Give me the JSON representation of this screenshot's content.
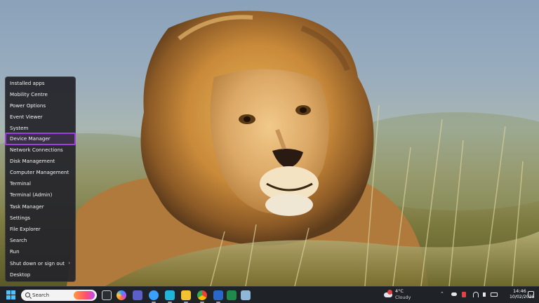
{
  "win_x_menu": {
    "items": [
      {
        "label": "Installed apps"
      },
      {
        "label": "Mobility Centre"
      },
      {
        "label": "Power Options"
      },
      {
        "label": "Event Viewer"
      },
      {
        "label": "System"
      },
      {
        "label": "Device Manager",
        "highlighted": true
      },
      {
        "label": "Network Connections"
      },
      {
        "label": "Disk Management"
      },
      {
        "label": "Computer Management"
      },
      {
        "label": "Terminal"
      },
      {
        "label": "Terminal (Admin)"
      },
      {
        "label": "Task Manager"
      },
      {
        "label": "Settings"
      },
      {
        "label": "File Explorer"
      },
      {
        "label": "Search"
      },
      {
        "label": "Run"
      },
      {
        "label": "Shut down or sign out",
        "submenu_indicator": "›"
      },
      {
        "label": "Desktop"
      }
    ],
    "highlight_color": "#9b3fe0"
  },
  "taskbar": {
    "search": {
      "placeholder": "Search"
    },
    "pinned_icons": [
      "task-view-icon",
      "copilot-icon",
      "teams-icon",
      "widgets-icon",
      "edge-icon",
      "file-explorer-icon",
      "chrome-icon",
      "word-icon",
      "excel-icon",
      "notepad-icon"
    ],
    "weather": {
      "temperature": "4°C",
      "condition": "Cloudy"
    },
    "tray_chevron": "⌃",
    "clock": {
      "time": "14:46",
      "date": "10/02/2025"
    }
  },
  "wallpaper": {
    "subject": "lion-wallpaper"
  },
  "colors": {
    "taskbar_bg": "#1f2226",
    "menu_bg": "#24242a",
    "start_blue": "#4cc2ff"
  }
}
